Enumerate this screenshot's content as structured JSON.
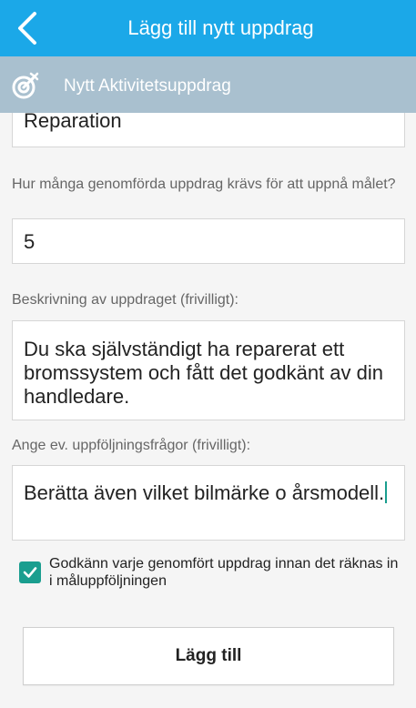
{
  "header": {
    "title": "Lägg till nytt uppdrag",
    "back_icon": "chevron-left-icon",
    "background": "#1ba8e8"
  },
  "subheader": {
    "title": "Nytt Aktivitetsuppdrag",
    "icon": "target-icon",
    "background": "#a9c0cf"
  },
  "form": {
    "name_value": "Reparation",
    "count_label": "Hur många genomförda uppdrag krävs för att uppnå målet?",
    "count_value": "5",
    "description_label": "Beskrivning av uppdraget (frivilligt):",
    "description_value": "Du ska självständigt ha reparerat ett bromssystem och fått det godkänt av din handledare.",
    "followup_label": "Ange ev. uppföljningsfrågor (frivilligt):",
    "followup_value": "Berätta även vilket bilmärke o årsmodell.",
    "approve_checkbox_label": "Godkänn varje genomfört uppdrag innan det räknas in i måluppföljningen",
    "approve_checked": true,
    "accent_color": "#1a9e8f"
  },
  "actions": {
    "add_label": "Lägg till"
  }
}
